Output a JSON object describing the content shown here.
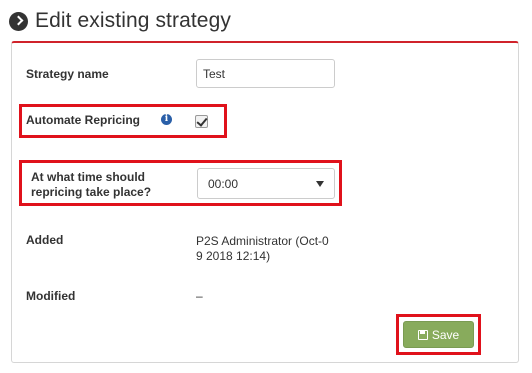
{
  "page": {
    "title": "Edit existing strategy"
  },
  "form": {
    "strategy_name": {
      "label": "Strategy name",
      "value": "Test"
    },
    "automate_repricing": {
      "label": "Automate Repricing",
      "checked": true,
      "info_icon": "info-circle-icon"
    },
    "repricing_time": {
      "label_line1": "At what time should",
      "label_line2": "repricing take place?",
      "selected": "00:00"
    },
    "added": {
      "label": "Added",
      "value_line1": "P2S Administrator (Oct-0",
      "value_line2": "9 2018 12:14)"
    },
    "modified": {
      "label": "Modified",
      "value": "–"
    }
  },
  "actions": {
    "save_label": "Save",
    "save_icon": "floppy-disk-icon"
  },
  "colors": {
    "accent_red": "#d0232b",
    "highlight_red": "#e0111b",
    "save_green": "#88ab5c"
  }
}
